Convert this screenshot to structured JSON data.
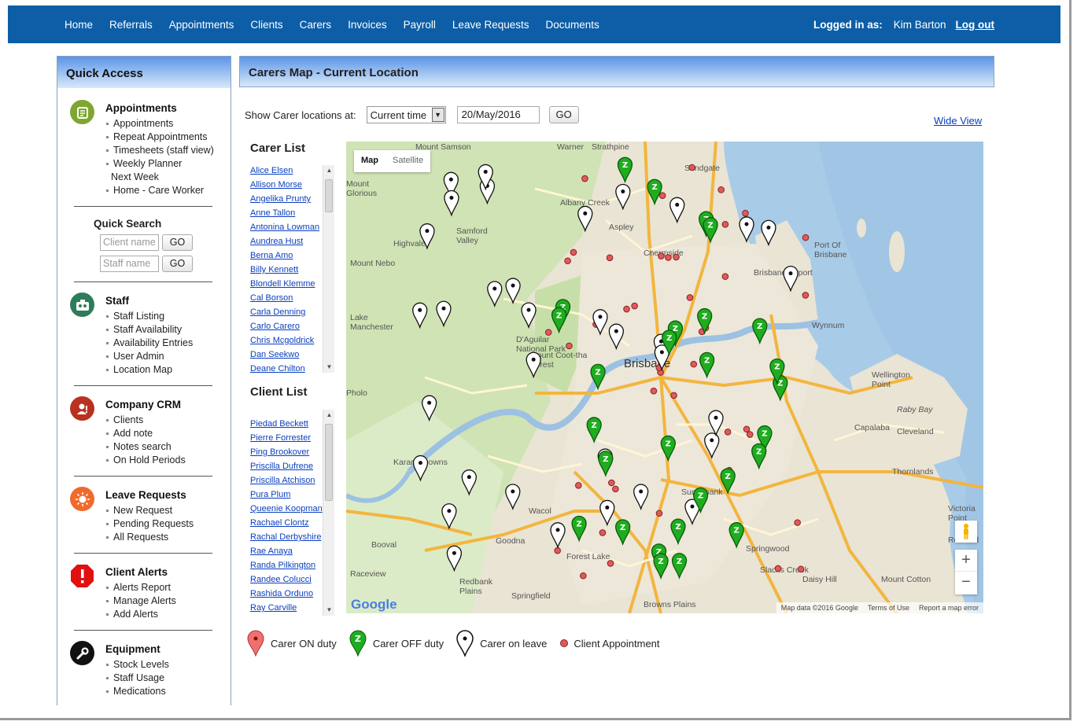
{
  "nav": {
    "items": [
      "Home",
      "Referrals",
      "Appointments",
      "Clients",
      "Carers",
      "Invoices",
      "Payroll",
      "Leave Requests",
      "Documents"
    ],
    "logged_in_label": "Logged in as:",
    "user": "Kim Barton",
    "logout": "Log out"
  },
  "sidebar": {
    "title": "Quick Access",
    "appointments": {
      "title": "Appointments",
      "items": [
        "Appointments",
        "Repeat Appointments",
        "Timesheets (staff view)",
        "Weekly Planner",
        "Next Week",
        "Home - Care Worker"
      ]
    },
    "quick_search": {
      "title": "Quick Search",
      "client_placeholder": "Client name",
      "staff_placeholder": "Staff name",
      "go": "GO"
    },
    "staff": {
      "title": "Staff",
      "items": [
        "Staff Listing",
        "Staff Availability",
        "Availability Entries",
        "User Admin",
        "Location Map"
      ]
    },
    "crm": {
      "title": "Company CRM",
      "items": [
        "Clients",
        "Add note",
        "Notes search",
        "On Hold Periods"
      ]
    },
    "leave": {
      "title": "Leave Requests",
      "items": [
        "New Request",
        "Pending Requests",
        "All Requests"
      ]
    },
    "alerts": {
      "title": "Client Alerts",
      "items": [
        "Alerts Report",
        "Manage Alerts",
        "Add Alerts"
      ]
    },
    "equipment": {
      "title": "Equipment",
      "items": [
        "Stock Levels",
        "Staff Usage",
        "Medications"
      ]
    }
  },
  "main": {
    "title": "Carers Map - Current Location",
    "show_label": "Show Carer locations at:",
    "time_select": "Current time",
    "date": "20/May/2016",
    "go": "GO",
    "wide_view": "Wide View"
  },
  "carer_list": {
    "title": "Carer List",
    "items": [
      "Alice Elsen",
      "Allison Morse",
      "Angelika Prunty",
      "Anne Tallon",
      "Antonina Lowman",
      "Aundrea Hust",
      "Berna Amo",
      "Billy Kennett",
      "Blondell Klemme",
      "Cal Borson",
      "Carla Denning",
      "Carlo Carero",
      "Chris Mcgoldrick",
      "Dan Seekwo",
      "Deane Chilton"
    ]
  },
  "client_list": {
    "title": "Client List",
    "items": [
      "Piedad Beckett",
      "Pierre Forrester",
      "Ping Brookover",
      "Priscilla Dufrene",
      "Priscilla Atchison",
      "Pura Plum",
      "Queenie Koopman",
      "Rachael Clontz",
      "Rachal Derbyshire",
      "Rae Anaya",
      "Randa Pilkington",
      "Randee Colucci",
      "Rashida Orduno",
      "Ray Carville"
    ]
  },
  "map": {
    "type_map": "Map",
    "type_satellite": "Satellite",
    "zoom_in": "+",
    "zoom_out": "−",
    "attribution": [
      "Map data ©2016 Google",
      "Terms of Use",
      "Report a map error"
    ],
    "logo": "Google",
    "labels": [
      {
        "t": "Mount Samson"
      },
      {
        "t": "Warner"
      },
      {
        "t": "Strathpine"
      },
      {
        "t": "Sandgate"
      },
      {
        "t": "Mount\nGlorious"
      },
      {
        "t": "Albany Creek"
      },
      {
        "t": "Aspley"
      },
      {
        "t": "Samford\nValley"
      },
      {
        "t": "Highvale"
      },
      {
        "t": "Mount Nebo"
      },
      {
        "t": "Chermside"
      },
      {
        "t": "Port Of\nBrisbane"
      },
      {
        "t": "Brisbane Airport"
      },
      {
        "t": "Lake\nManchester"
      },
      {
        "t": "D'Aguilar\nNational Park"
      },
      {
        "t": "Wynnum"
      },
      {
        "t": "Mount Coot-tha\nForest"
      },
      {
        "t": "Brisbane"
      },
      {
        "t": "Wellington\nPoint"
      },
      {
        "t": "Raby Bay"
      },
      {
        "t": "Capalaba"
      },
      {
        "t": "Cleveland"
      },
      {
        "t": "Karana Downs"
      },
      {
        "t": "Thornlands"
      },
      {
        "t": "Sunnybank"
      },
      {
        "t": "Victoria\nPoint"
      },
      {
        "t": "Redland"
      },
      {
        "t": "Goodna"
      },
      {
        "t": "Booval"
      },
      {
        "t": "Springwood"
      },
      {
        "t": "Forest Lake"
      },
      {
        "t": "Slacks Creek"
      },
      {
        "t": "Raceview"
      },
      {
        "t": "Daisy Hill"
      },
      {
        "t": "Mount Cotton"
      },
      {
        "t": "Redbank\nPlains"
      },
      {
        "t": "Springfield"
      },
      {
        "t": "Browns Plains"
      },
      {
        "t": "Wacol"
      },
      {
        "t": "Pholo"
      }
    ],
    "carers_off": 28,
    "carers_leave": 34,
    "appointments": 45
  },
  "legend": {
    "on_duty": "Carer ON duty",
    "off_duty": "Carer OFF duty",
    "on_leave": "Carer on leave",
    "appointment": "Client Appointment"
  },
  "colors": {
    "nav_bg": "#0d5ea6",
    "panel_gradient_top": "#5b95e7",
    "pin_on_duty": "#f07070",
    "pin_off_duty": "#1fad1f",
    "pin_leave": "#ffffff",
    "appointment_dot": "#e05a5a",
    "link": "#0a3fbf"
  }
}
